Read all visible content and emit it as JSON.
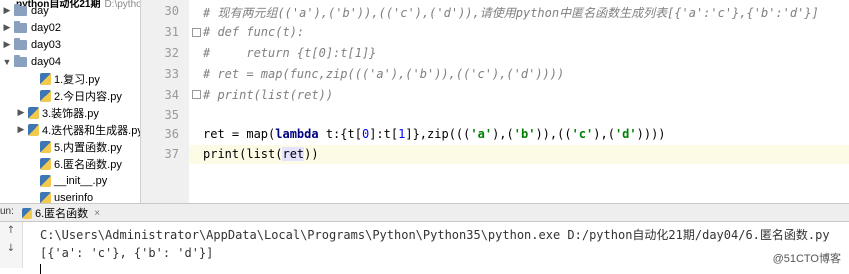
{
  "project": {
    "title": "python自动化21期",
    "path": "D:\\python",
    "items": [
      {
        "label": "day",
        "type": "folder",
        "arrow": "▶"
      },
      {
        "label": "day02",
        "type": "folder",
        "arrow": "▶"
      },
      {
        "label": "day03",
        "type": "folder",
        "arrow": "▶"
      },
      {
        "label": "day04",
        "type": "folder",
        "arrow": "▼"
      },
      {
        "label": "1.复习.py",
        "type": "file",
        "arrow": ""
      },
      {
        "label": "2.今日内容.py",
        "type": "file",
        "arrow": ""
      },
      {
        "label": "3.装饰器.py",
        "type": "file",
        "arrow": "▶"
      },
      {
        "label": "4.迭代器和生成器.py",
        "type": "file",
        "arrow": "▶"
      },
      {
        "label": "5.内置函数.py",
        "type": "file",
        "arrow": ""
      },
      {
        "label": "6.匿名函数.py",
        "type": "file",
        "arrow": ""
      },
      {
        "label": "__init__.py",
        "type": "file",
        "arrow": ""
      },
      {
        "label": "userinfo",
        "type": "file",
        "arrow": ""
      }
    ]
  },
  "editor": {
    "line_numbers": [
      "30",
      "31",
      "32",
      "33",
      "34",
      "35",
      "36",
      "37"
    ],
    "lines": {
      "l30": "# 现有两元组(('a'),('b')),(('c'),('d')),请使用python中匿名函数生成列表[{'a':'c'},{'b':'d'}]",
      "l31": "# def func(t):",
      "l32": "#     return {t[0]:t[1]}",
      "l33": "# ret = map(func,zip((('a'),('b')),(('c'),('d'))))",
      "l34": "# print(list(ret))",
      "l36": {
        "a": "ret = map(",
        "kw": "lambda",
        "b": " t:{t[",
        "n1": "0",
        "c": "]:t[",
        "n2": "1",
        "d": "]},zip(((",
        "s1": "'a'",
        "e": "),(",
        "s2": "'b'",
        "f": ")),((",
        "s3": "'c'",
        "g": "),(",
        "s4": "'d'",
        "h": "))))"
      },
      "l37": {
        "a": "print(list(",
        "hl": "ret",
        "b": "))"
      }
    }
  },
  "run": {
    "label": "un:",
    "tab_label": "6.匿名函数",
    "close": "×"
  },
  "console": {
    "command": "C:\\Users\\Administrator\\AppData\\Local\\Programs\\Python\\Python35\\python.exe D:/python自动化21期/day04/6.匿名函数.py",
    "output": "[{'a': 'c'}, {'b': 'd'}]"
  },
  "watermark": "@51CTO博客",
  "colors": {
    "keyword": "#000080",
    "string": "#008000",
    "number": "#0000ff",
    "comment": "#808080",
    "current_line": "#fdfbe6"
  }
}
